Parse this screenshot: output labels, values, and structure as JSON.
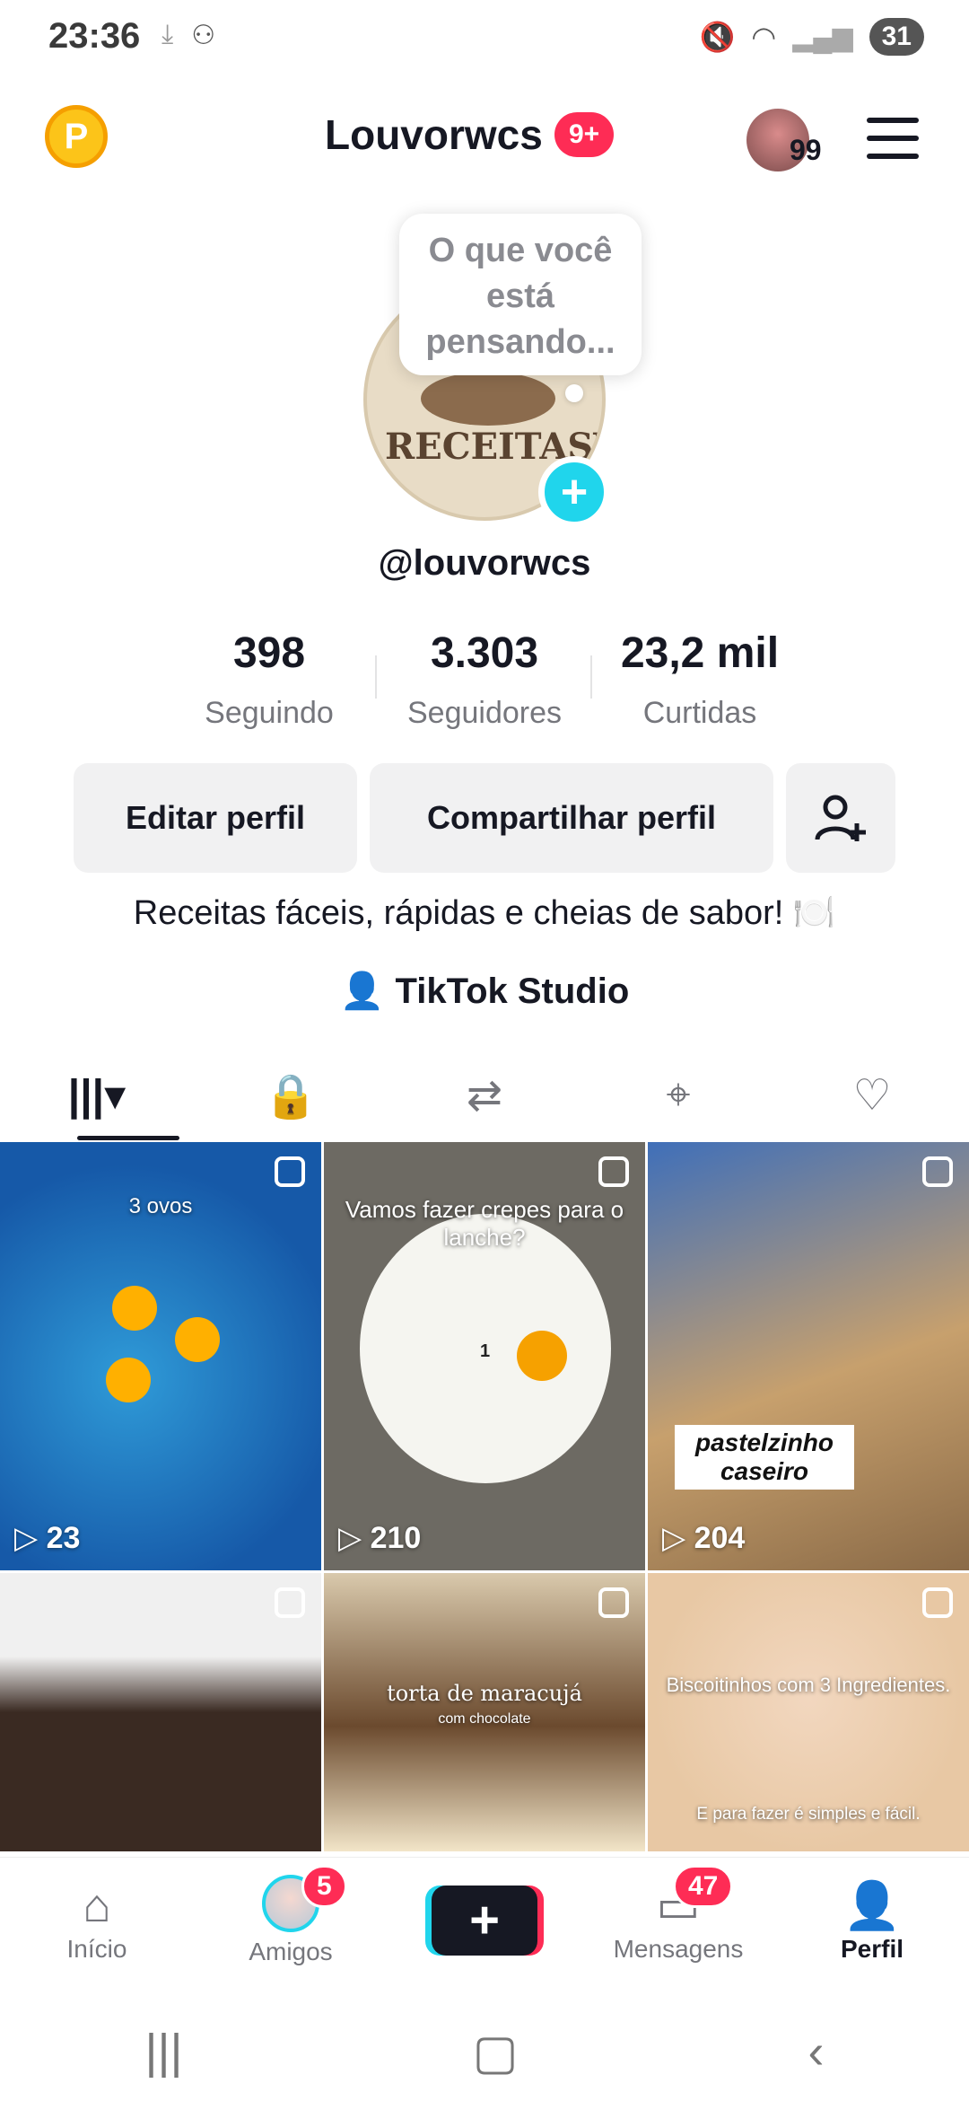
{
  "status_bar": {
    "time": "23:36",
    "battery": "31"
  },
  "header": {
    "title": "Louvorwcs",
    "notification_badge": "9+",
    "coin_letter": "P",
    "avatar_count": "99"
  },
  "profile": {
    "thought_bubble": "O que você está pensando...",
    "logo_text": "RECEITASWCS",
    "handle": "@louvorwcs",
    "stats": [
      {
        "value": "398",
        "label": "Seguindo"
      },
      {
        "value": "3.303",
        "label": "Seguidores"
      },
      {
        "value": "23,2 mil",
        "label": "Curtidas"
      }
    ],
    "buttons": {
      "edit": "Editar perfil",
      "share": "Compartilhar perfil"
    },
    "bio": "Receitas fáceis, rápidas e cheias de sabor! 🍽️",
    "studio": "TikTok Studio"
  },
  "videos": [
    {
      "views": "23",
      "caption": "3 ovos"
    },
    {
      "views": "210",
      "caption": "Vamos fazer crepes para o lanche?",
      "overlay_number": "1"
    },
    {
      "views": "204",
      "caption": "pastelzinho caseiro"
    },
    {
      "views": "",
      "caption": ""
    },
    {
      "views": "",
      "caption": "torta de maracujá",
      "subcaption": "com chocolate"
    },
    {
      "views": "",
      "caption": "Biscoitinhos com 3 Ingredientes.",
      "footer": "E para fazer é simples e fácil."
    }
  ],
  "bottom_nav": {
    "home": "Início",
    "friends": "Amigos",
    "friends_badge": "5",
    "messages": "Mensagens",
    "messages_badge": "47",
    "profile": "Perfil"
  }
}
